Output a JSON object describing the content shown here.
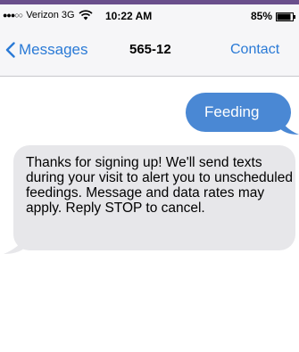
{
  "status_bar": {
    "signal": "●●●○○",
    "carrier": "Verizon 3G",
    "time": "10:22 AM",
    "battery": "85%",
    "icons": [
      "wifi-icon",
      "battery-icon"
    ]
  },
  "nav": {
    "back_label": "Messages",
    "title": "565-12",
    "contact_label": "Contact",
    "back_icon": "chevron-left-icon"
  },
  "messages": [
    {
      "direction": "sent",
      "text": "Feeding"
    },
    {
      "direction": "received",
      "text": "Thanks for signing up! We'll send texts during your visit to alert you to unscheduled feedings. Message and data rates may apply. Reply STOP to cancel."
    }
  ],
  "colors": {
    "accent": "#2a7ad6",
    "sent_bubble": "#4a88d4",
    "received_bubble": "#e7e7ea"
  }
}
